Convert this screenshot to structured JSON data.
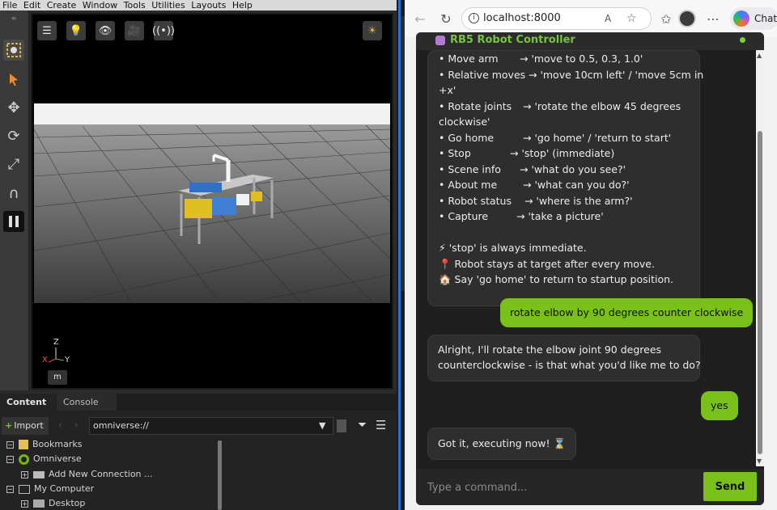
{
  "omniverse": {
    "menu": [
      "File",
      "Edit",
      "Create",
      "Window",
      "Tools",
      "Utilities",
      "Layouts",
      "Help"
    ],
    "viewport": {
      "unit": "m",
      "axis_labels": {
        "z": "Z",
        "x": "X",
        "y": "Y"
      }
    },
    "content_panel": {
      "tabs": [
        "Content",
        "Console"
      ],
      "import_label": "Import",
      "path": "omniverse://",
      "tree": [
        {
          "label": "Bookmarks",
          "icon": "bookmark-icon"
        },
        {
          "label": "Omniverse",
          "icon": "omniverse-icon"
        },
        {
          "label": "Add New Connection ...",
          "icon": "connection-icon"
        },
        {
          "label": "My Computer",
          "icon": "computer-icon"
        },
        {
          "label": "Desktop",
          "icon": "folder-icon"
        }
      ]
    }
  },
  "browser": {
    "url": "localhost:8000",
    "chat_label": "Chat"
  },
  "app": {
    "title": "RB5 Robot Controller",
    "help_lines": [
      {
        "label": "• Move arm",
        "cmd": "→ 'move to 0.5, 0.3, 1.0'"
      },
      {
        "label": "• Relative moves",
        "cmd": "→ 'move 10cm left' / 'move 5cm in"
      },
      {
        "label": "+x'",
        "cmd": ""
      },
      {
        "label": "• Rotate joints",
        "cmd": "→ 'rotate the elbow 45 degrees"
      },
      {
        "label": "clockwise'",
        "cmd": ""
      },
      {
        "label": "• Go home",
        "cmd": "→ 'go home' / 'return to start'"
      },
      {
        "label": "• Stop",
        "cmd": "→ 'stop' (immediate)"
      },
      {
        "label": "• Scene info",
        "cmd": "→ 'what do you see?'"
      },
      {
        "label": "• About me",
        "cmd": "→ 'what can you do?'"
      },
      {
        "label": "• Robot status",
        "cmd": "→ 'where is the arm?'"
      },
      {
        "label": "• Capture",
        "cmd": "→ 'take a picture'"
      }
    ],
    "notes": [
      "⚡ 'stop' is always immediate.",
      "📍 Robot stays at target after every move.",
      "🏠 Say 'go home' to return to startup position."
    ],
    "user_msg_1": "rotate elbow by 90 degrees counter clockwise",
    "bot_msg_1_line1": "Alright, I'll rotate the elbow joint 90 degrees",
    "bot_msg_1_line2": "counterclockwise - is that what you'd like me to do?",
    "user_msg_2": "yes",
    "bot_msg_2": "Got it, executing now! ⌛",
    "input_placeholder": "Type a command...",
    "send_label": "Send"
  }
}
